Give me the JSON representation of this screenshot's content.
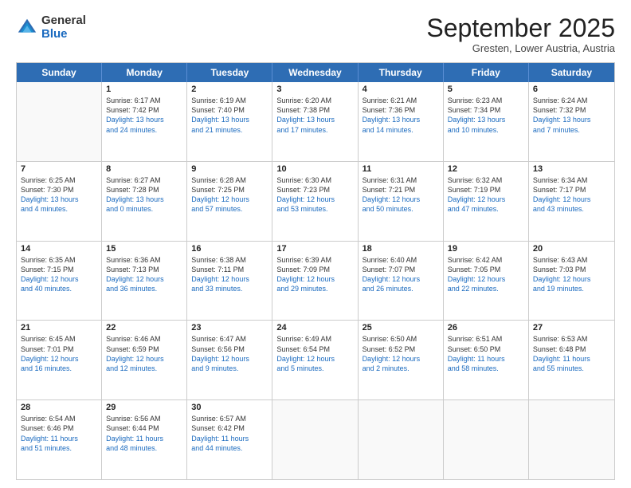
{
  "logo": {
    "general": "General",
    "blue": "Blue"
  },
  "title": "September 2025",
  "subtitle": "Gresten, Lower Austria, Austria",
  "days": [
    "Sunday",
    "Monday",
    "Tuesday",
    "Wednesday",
    "Thursday",
    "Friday",
    "Saturday"
  ],
  "weeks": [
    [
      {
        "day": "",
        "sunrise": "",
        "sunset": "",
        "daylight": "",
        "empty": true
      },
      {
        "day": "1",
        "sunrise": "Sunrise: 6:17 AM",
        "sunset": "Sunset: 7:42 PM",
        "daylight": "Daylight: 13 hours and 24 minutes."
      },
      {
        "day": "2",
        "sunrise": "Sunrise: 6:19 AM",
        "sunset": "Sunset: 7:40 PM",
        "daylight": "Daylight: 13 hours and 21 minutes."
      },
      {
        "day": "3",
        "sunrise": "Sunrise: 6:20 AM",
        "sunset": "Sunset: 7:38 PM",
        "daylight": "Daylight: 13 hours and 17 minutes."
      },
      {
        "day": "4",
        "sunrise": "Sunrise: 6:21 AM",
        "sunset": "Sunset: 7:36 PM",
        "daylight": "Daylight: 13 hours and 14 minutes."
      },
      {
        "day": "5",
        "sunrise": "Sunrise: 6:23 AM",
        "sunset": "Sunset: 7:34 PM",
        "daylight": "Daylight: 13 hours and 10 minutes."
      },
      {
        "day": "6",
        "sunrise": "Sunrise: 6:24 AM",
        "sunset": "Sunset: 7:32 PM",
        "daylight": "Daylight: 13 hours and 7 minutes."
      }
    ],
    [
      {
        "day": "7",
        "sunrise": "Sunrise: 6:25 AM",
        "sunset": "Sunset: 7:30 PM",
        "daylight": "Daylight: 13 hours and 4 minutes."
      },
      {
        "day": "8",
        "sunrise": "Sunrise: 6:27 AM",
        "sunset": "Sunset: 7:28 PM",
        "daylight": "Daylight: 13 hours and 0 minutes."
      },
      {
        "day": "9",
        "sunrise": "Sunrise: 6:28 AM",
        "sunset": "Sunset: 7:25 PM",
        "daylight": "Daylight: 12 hours and 57 minutes."
      },
      {
        "day": "10",
        "sunrise": "Sunrise: 6:30 AM",
        "sunset": "Sunset: 7:23 PM",
        "daylight": "Daylight: 12 hours and 53 minutes."
      },
      {
        "day": "11",
        "sunrise": "Sunrise: 6:31 AM",
        "sunset": "Sunset: 7:21 PM",
        "daylight": "Daylight: 12 hours and 50 minutes."
      },
      {
        "day": "12",
        "sunrise": "Sunrise: 6:32 AM",
        "sunset": "Sunset: 7:19 PM",
        "daylight": "Daylight: 12 hours and 47 minutes."
      },
      {
        "day": "13",
        "sunrise": "Sunrise: 6:34 AM",
        "sunset": "Sunset: 7:17 PM",
        "daylight": "Daylight: 12 hours and 43 minutes."
      }
    ],
    [
      {
        "day": "14",
        "sunrise": "Sunrise: 6:35 AM",
        "sunset": "Sunset: 7:15 PM",
        "daylight": "Daylight: 12 hours and 40 minutes."
      },
      {
        "day": "15",
        "sunrise": "Sunrise: 6:36 AM",
        "sunset": "Sunset: 7:13 PM",
        "daylight": "Daylight: 12 hours and 36 minutes."
      },
      {
        "day": "16",
        "sunrise": "Sunrise: 6:38 AM",
        "sunset": "Sunset: 7:11 PM",
        "daylight": "Daylight: 12 hours and 33 minutes."
      },
      {
        "day": "17",
        "sunrise": "Sunrise: 6:39 AM",
        "sunset": "Sunset: 7:09 PM",
        "daylight": "Daylight: 12 hours and 29 minutes."
      },
      {
        "day": "18",
        "sunrise": "Sunrise: 6:40 AM",
        "sunset": "Sunset: 7:07 PM",
        "daylight": "Daylight: 12 hours and 26 minutes."
      },
      {
        "day": "19",
        "sunrise": "Sunrise: 6:42 AM",
        "sunset": "Sunset: 7:05 PM",
        "daylight": "Daylight: 12 hours and 22 minutes."
      },
      {
        "day": "20",
        "sunrise": "Sunrise: 6:43 AM",
        "sunset": "Sunset: 7:03 PM",
        "daylight": "Daylight: 12 hours and 19 minutes."
      }
    ],
    [
      {
        "day": "21",
        "sunrise": "Sunrise: 6:45 AM",
        "sunset": "Sunset: 7:01 PM",
        "daylight": "Daylight: 12 hours and 16 minutes."
      },
      {
        "day": "22",
        "sunrise": "Sunrise: 6:46 AM",
        "sunset": "Sunset: 6:59 PM",
        "daylight": "Daylight: 12 hours and 12 minutes."
      },
      {
        "day": "23",
        "sunrise": "Sunrise: 6:47 AM",
        "sunset": "Sunset: 6:56 PM",
        "daylight": "Daylight: 12 hours and 9 minutes."
      },
      {
        "day": "24",
        "sunrise": "Sunrise: 6:49 AM",
        "sunset": "Sunset: 6:54 PM",
        "daylight": "Daylight: 12 hours and 5 minutes."
      },
      {
        "day": "25",
        "sunrise": "Sunrise: 6:50 AM",
        "sunset": "Sunset: 6:52 PM",
        "daylight": "Daylight: 12 hours and 2 minutes."
      },
      {
        "day": "26",
        "sunrise": "Sunrise: 6:51 AM",
        "sunset": "Sunset: 6:50 PM",
        "daylight": "Daylight: 11 hours and 58 minutes."
      },
      {
        "day": "27",
        "sunrise": "Sunrise: 6:53 AM",
        "sunset": "Sunset: 6:48 PM",
        "daylight": "Daylight: 11 hours and 55 minutes."
      }
    ],
    [
      {
        "day": "28",
        "sunrise": "Sunrise: 6:54 AM",
        "sunset": "Sunset: 6:46 PM",
        "daylight": "Daylight: 11 hours and 51 minutes."
      },
      {
        "day": "29",
        "sunrise": "Sunrise: 6:56 AM",
        "sunset": "Sunset: 6:44 PM",
        "daylight": "Daylight: 11 hours and 48 minutes."
      },
      {
        "day": "30",
        "sunrise": "Sunrise: 6:57 AM",
        "sunset": "Sunset: 6:42 PM",
        "daylight": "Daylight: 11 hours and 44 minutes."
      },
      {
        "day": "",
        "sunrise": "",
        "sunset": "",
        "daylight": "",
        "empty": true
      },
      {
        "day": "",
        "sunrise": "",
        "sunset": "",
        "daylight": "",
        "empty": true
      },
      {
        "day": "",
        "sunrise": "",
        "sunset": "",
        "daylight": "",
        "empty": true
      },
      {
        "day": "",
        "sunrise": "",
        "sunset": "",
        "daylight": "",
        "empty": true
      }
    ]
  ]
}
